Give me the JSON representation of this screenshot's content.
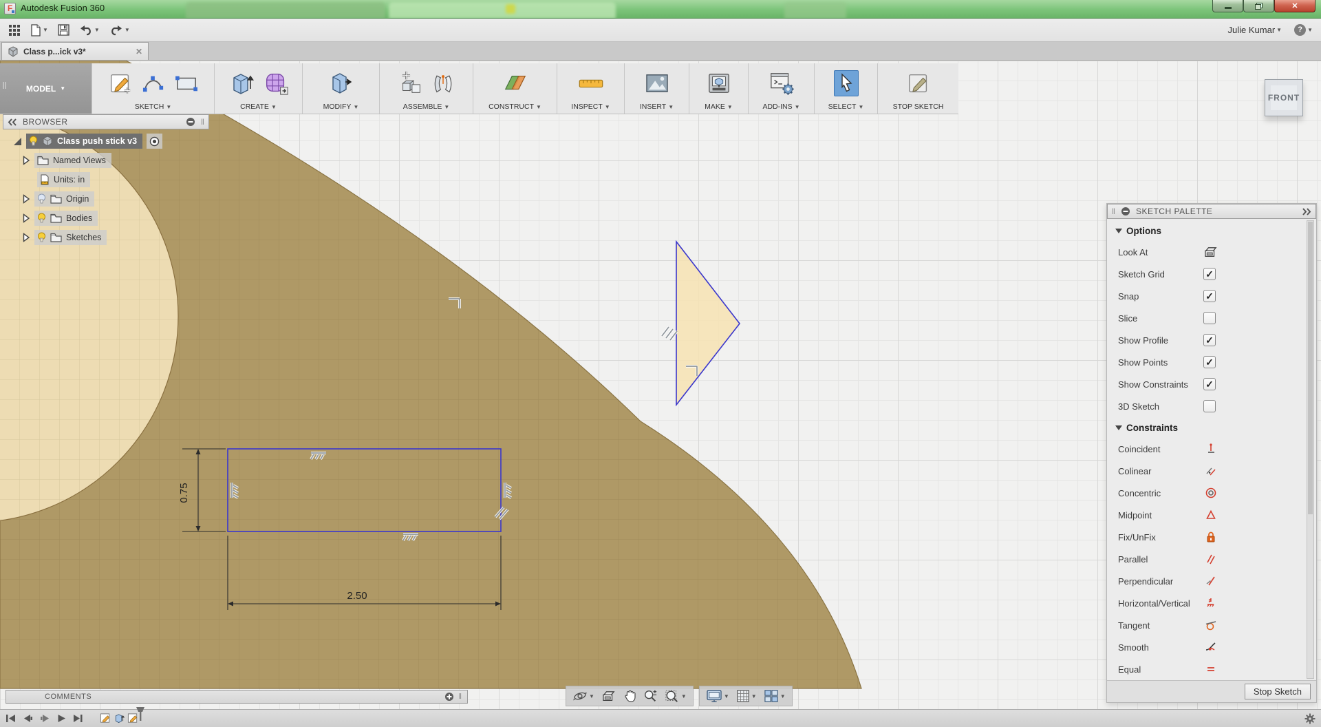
{
  "window": {
    "title": "Autodesk Fusion 360"
  },
  "appbar": {
    "user": "Julie Kumar",
    "help_label": "?"
  },
  "tabbar": {
    "active_tab": "Class p...ick v3*"
  },
  "toolbar": {
    "workspace_label": "MODEL",
    "sections": [
      {
        "label": "SKETCH",
        "icons": [
          "create-sketch-icon",
          "spline-icon",
          "rectangle-icon"
        ]
      },
      {
        "label": "CREATE",
        "icons": [
          "extrude-icon",
          "form-icon"
        ]
      },
      {
        "label": "MODIFY",
        "icons": [
          "press-pull-icon"
        ]
      },
      {
        "label": "ASSEMBLE",
        "icons": [
          "new-component-icon",
          "joint-icon"
        ]
      },
      {
        "label": "CONSTRUCT",
        "icons": [
          "construct-plane-icon"
        ]
      },
      {
        "label": "INSPECT",
        "icons": [
          "measure-icon"
        ]
      },
      {
        "label": "INSERT",
        "icons": [
          "insert-image-icon"
        ]
      },
      {
        "label": "MAKE",
        "icons": [
          "make-3dprint-icon"
        ]
      },
      {
        "label": "ADD-INS",
        "icons": [
          "addins-scripts-icon"
        ]
      },
      {
        "label": "SELECT",
        "icons": [
          "select-cursor-icon"
        ]
      },
      {
        "label": "STOP SKETCH",
        "icons": [
          "stop-sketch-icon"
        ]
      }
    ]
  },
  "browser": {
    "title": "BROWSER",
    "root_label": "Class push stick v3",
    "items": [
      {
        "label": "Named Views",
        "icon": "folder-icon",
        "bulb": null
      },
      {
        "label": "Units: in",
        "icon": "units-doc-icon",
        "bulb": null
      },
      {
        "label": "Origin",
        "icon": "folder-icon",
        "bulb": "off"
      },
      {
        "label": "Bodies",
        "icon": "folder-icon",
        "bulb": "on"
      },
      {
        "label": "Sketches",
        "icon": "folder-icon",
        "bulb": "on"
      }
    ]
  },
  "viewcube": {
    "face": "FRONT"
  },
  "canvas": {
    "dim_height": "0.75",
    "dim_width": "2.50"
  },
  "palette": {
    "title": "SKETCH PALETTE",
    "options_title": "Options",
    "options": [
      {
        "label": "Look At",
        "control": "look-at-icon"
      },
      {
        "label": "Sketch Grid",
        "checked": true
      },
      {
        "label": "Snap",
        "checked": true
      },
      {
        "label": "Slice",
        "checked": false
      },
      {
        "label": "Show Profile",
        "checked": true
      },
      {
        "label": "Show Points",
        "checked": true
      },
      {
        "label": "Show Constraints",
        "checked": true
      },
      {
        "label": "3D Sketch",
        "checked": false
      }
    ],
    "constraints_title": "Constraints",
    "constraints": [
      {
        "label": "Coincident",
        "icon": "coincident-icon"
      },
      {
        "label": "Colinear",
        "icon": "colinear-icon"
      },
      {
        "label": "Concentric",
        "icon": "concentric-icon"
      },
      {
        "label": "Midpoint",
        "icon": "midpoint-icon"
      },
      {
        "label": "Fix/UnFix",
        "icon": "fix-unfix-icon"
      },
      {
        "label": "Parallel",
        "icon": "parallel-icon"
      },
      {
        "label": "Perpendicular",
        "icon": "perpendicular-icon"
      },
      {
        "label": "Horizontal/Vertical",
        "icon": "horizontal-vertical-icon"
      },
      {
        "label": "Tangent",
        "icon": "tangent-icon"
      },
      {
        "label": "Smooth",
        "icon": "smooth-icon"
      },
      {
        "label": "Equal",
        "icon": "equal-icon"
      }
    ],
    "stop_sketch_label": "Stop Sketch"
  },
  "comments": {
    "title": "COMMENTS"
  },
  "navbar": {
    "group1": [
      "orbit-icon",
      "look-at-icon",
      "pan-icon",
      "zoom-icon",
      "zoom-window-icon"
    ],
    "group2": [
      "display-settings-icon",
      "grid-settings-icon",
      "viewports-icon"
    ]
  },
  "timeline": {
    "controls": [
      "skip-start-icon",
      "step-back-icon",
      "step-forward-icon",
      "play-icon",
      "skip-end-icon"
    ],
    "features": [
      "sketch-feature-icon",
      "extrude-feature-icon",
      "sketch-feature-icon"
    ]
  },
  "colors": {
    "titlebar_green": "#7cc47a",
    "body_tan": "#af9966",
    "profile_cream": "#eddcb3",
    "profile_highlight": "#f6e2b4",
    "sketch_blue": "#3a36cc",
    "select_highlight": "#6ea3d8",
    "constraint_red": "#d43f2f",
    "constraint_orange": "#e0641f"
  }
}
